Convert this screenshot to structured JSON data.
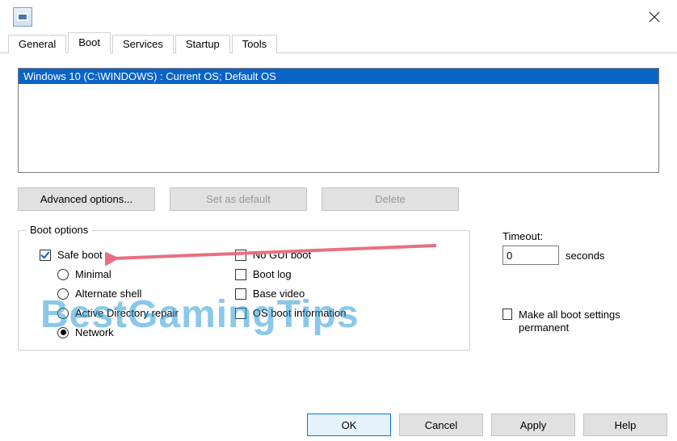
{
  "window": {
    "close_label": "Close"
  },
  "tabs": {
    "general": "General",
    "boot": "Boot",
    "services": "Services",
    "startup": "Startup",
    "tools": "Tools"
  },
  "os_list": {
    "selected": "Windows 10 (C:\\WINDOWS) : Current OS; Default OS"
  },
  "buttons": {
    "advanced": "Advanced options...",
    "set_default": "Set as default",
    "delete": "Delete"
  },
  "boot_options": {
    "legend": "Boot options",
    "safe_boot": "Safe boot",
    "minimal": "Minimal",
    "alternate_shell": "Alternate shell",
    "ad_repair": "Active Directory repair",
    "network": "Network",
    "no_gui": "No GUI boot",
    "boot_log": "Boot log",
    "base_video": "Base video",
    "os_boot_info": "OS boot information"
  },
  "timeout": {
    "label": "Timeout:",
    "value": "0",
    "unit": "seconds"
  },
  "permanent": {
    "label": "Make all boot settings permanent"
  },
  "footer": {
    "ok": "OK",
    "cancel": "Cancel",
    "apply": "Apply",
    "help": "Help"
  },
  "watermark": "BestGamingTips"
}
